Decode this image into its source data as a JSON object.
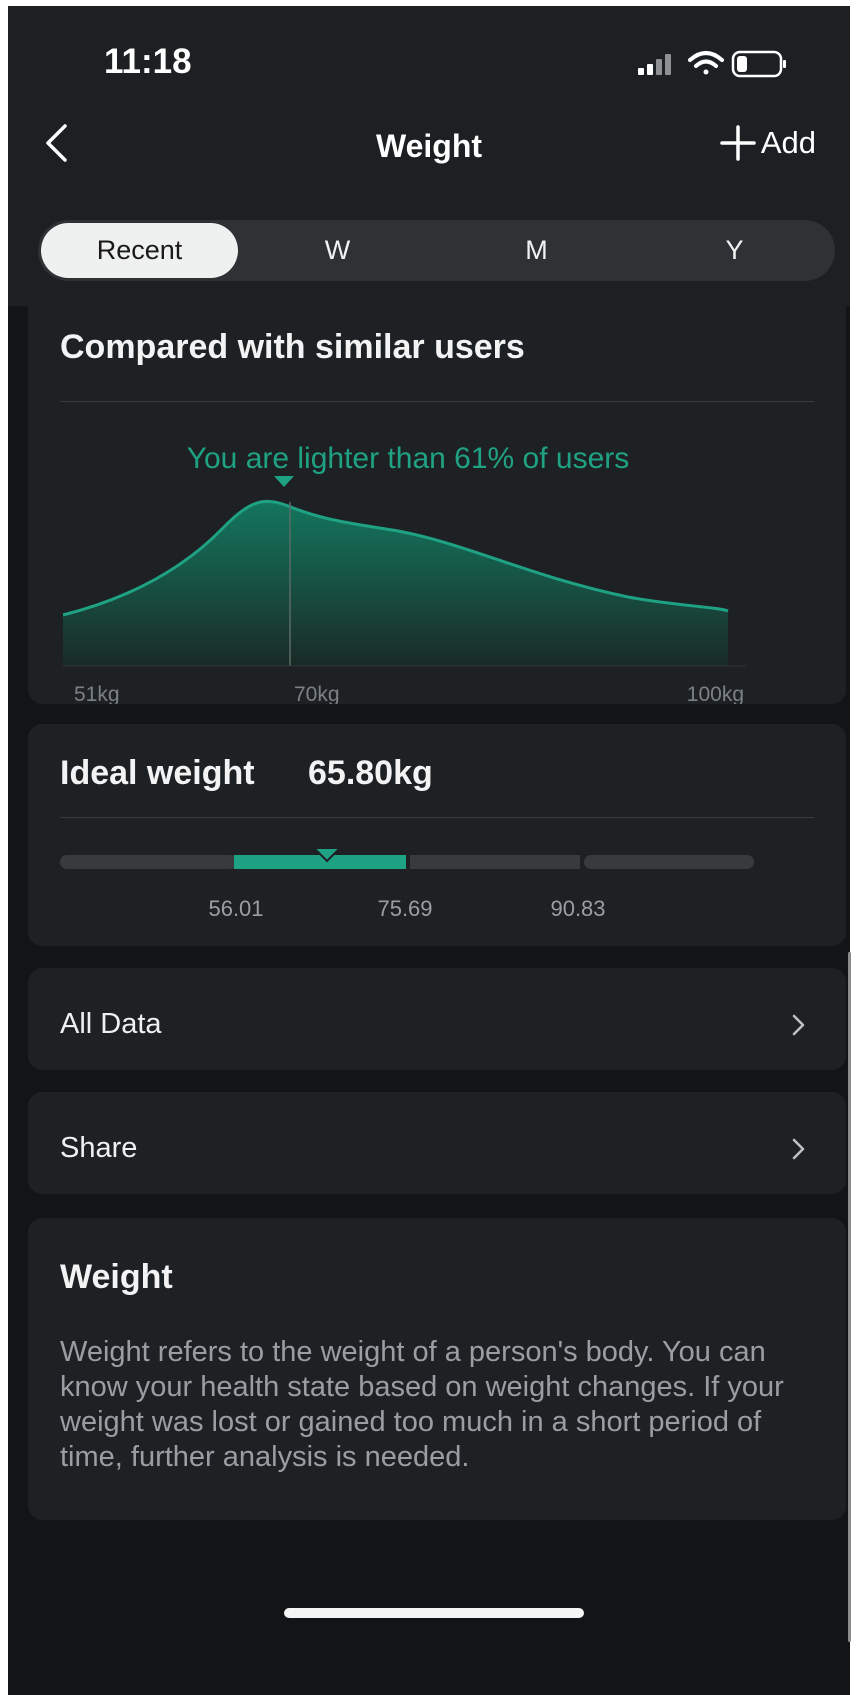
{
  "status_bar": {
    "time": "11:18"
  },
  "nav": {
    "title": "Weight",
    "add_label": "Add"
  },
  "tabs": [
    {
      "label": "Recent",
      "active": true
    },
    {
      "label": "W",
      "active": false
    },
    {
      "label": "M",
      "active": false
    },
    {
      "label": "Y",
      "active": false
    }
  ],
  "comparison": {
    "title": "Compared with similar users",
    "message": "You are lighter than 61% of users",
    "axis_labels": [
      "51kg",
      "70kg",
      "100kg"
    ],
    "accent_color": "#1fa283"
  },
  "ideal_weight": {
    "label": "Ideal weight",
    "value": "65.80kg",
    "thresholds": [
      "56.01",
      "75.69",
      "90.83"
    ]
  },
  "menu": [
    {
      "label": "All Data"
    },
    {
      "label": "Share"
    }
  ],
  "info": {
    "title": "Weight",
    "text": "Weight refers to the weight of a person's body. You can know your health state based on weight changes. If your weight was lost or gained too much in a short period of time, further analysis is needed."
  }
}
